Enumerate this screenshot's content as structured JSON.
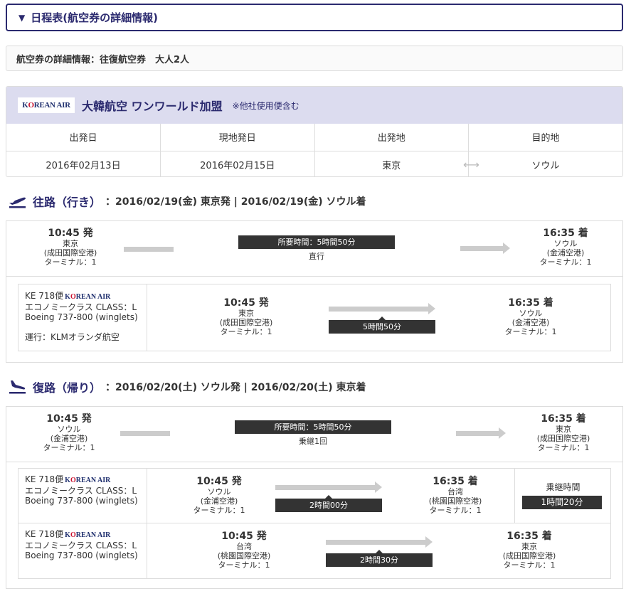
{
  "header": {
    "toggle_icon": "▼",
    "title": "日程表(航空券の詳細情報)"
  },
  "summary": {
    "text": "航空券の詳細情報：往復航空券　大人2人"
  },
  "airline": {
    "logo_prefix": "K",
    "logo_mid": "O",
    "logo_rest": "REAN AIR",
    "name": "大韓航空 ワンワールド加盟",
    "note": "※他社使用便含む",
    "headers": [
      "出発日",
      "現地発日",
      "出発地",
      "目的地"
    ],
    "values": [
      "2016年02月13日",
      "2016年02月15日",
      "東京",
      "ソウル"
    ]
  },
  "outbound": {
    "title": "往路（行き）",
    "summary": "：2016/02/19(金) 東京発 | 2016/02/19(金) ソウル着",
    "overview": {
      "dep_time": "10:45 発",
      "dep_city": "東京",
      "dep_airport": "(成田国際空港)",
      "dep_terminal": "ターミナル：1",
      "duration": "所要時間：5時間50分",
      "stops": "直行",
      "arr_time": "16:35 着",
      "arr_city": "ソウル",
      "arr_airport": "(金浦空港)",
      "arr_terminal": "ターミナル：1"
    },
    "segments": [
      {
        "flight": "KE 718便",
        "cabin": "エコノミークラス CLASS：L",
        "aircraft": "Boeing 737-800 (winglets)",
        "operated": "運行：KLMオランダ航空",
        "dep_time": "10:45 発",
        "dep_city": "東京",
        "dep_airport": "(成田国際空港)",
        "dep_terminal": "ターミナル：1",
        "duration": "5時間50分",
        "arr_time": "16:35 着",
        "arr_city": "ソウル",
        "arr_airport": "(金浦空港)",
        "arr_terminal": "ターミナル：1"
      }
    ]
  },
  "inbound": {
    "title": "復路（帰り）",
    "summary": "：2016/02/20(土) ソウル発 | 2016/02/20(土) 東京着",
    "overview": {
      "dep_time": "10:45 発",
      "dep_city": "ソウル",
      "dep_airport": "(金浦空港)",
      "dep_terminal": "ターミナル：1",
      "duration": "所要時間：5時間50分",
      "stops": "乗継1回",
      "arr_time": "16:35 着",
      "arr_city": "東京",
      "arr_airport": "(成田国際空港)",
      "arr_terminal": "ターミナル：1"
    },
    "segments": [
      {
        "flight": "KE 718便",
        "cabin": "エコノミークラス CLASS：L",
        "aircraft": "Boeing 737-800 (winglets)",
        "dep_time": "10:45 発",
        "dep_city": "ソウル",
        "dep_airport": "(金浦空港)",
        "dep_terminal": "ターミナル：1",
        "duration": "2時間00分",
        "arr_time": "16:35 着",
        "arr_city": "台湾",
        "arr_airport": "(桃園国際空港)",
        "arr_terminal": "ターミナル：1",
        "transfer_label": "乗継時間",
        "transfer_time": "1時間20分"
      },
      {
        "flight": "KE 718便",
        "cabin": "エコノミークラス CLASS：L",
        "aircraft": "Boeing 737-800 (winglets)",
        "dep_time": "10:45 発",
        "dep_city": "台湾",
        "dep_airport": "(桃園国際空港)",
        "dep_terminal": "ターミナル：1",
        "duration": "2時間30分",
        "arr_time": "16:35 着",
        "arr_city": "東京",
        "arr_airport": "(成田国際空港)",
        "arr_terminal": "ターミナル：1"
      }
    ]
  },
  "icons": {
    "outbound": "plane-takeoff-icon",
    "inbound": "plane-landing-icon",
    "swap": "double-arrow-icon"
  },
  "colors": {
    "accent": "#2b2a6f",
    "airline_band": "#dcdcef",
    "duration_box": "#333333",
    "bar": "#cccccc"
  }
}
